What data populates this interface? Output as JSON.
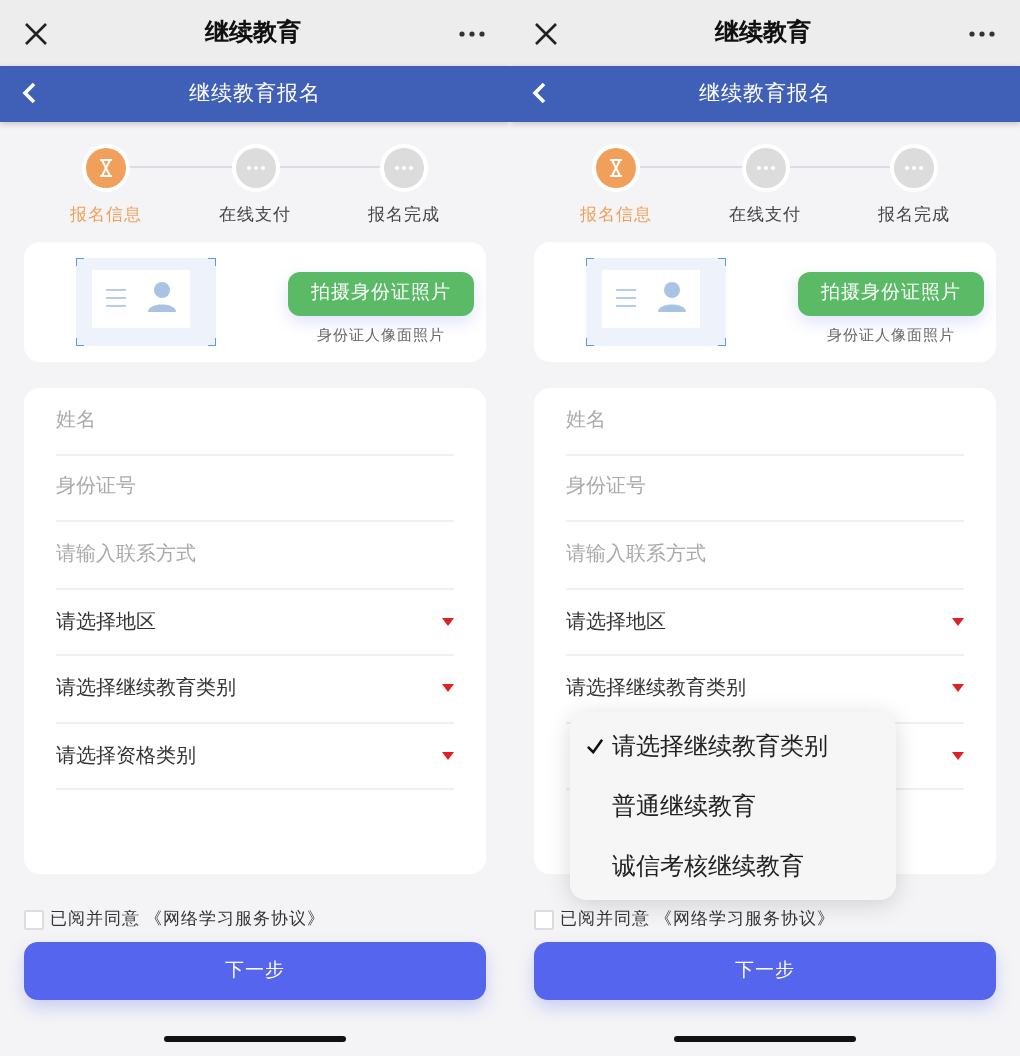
{
  "screens": [
    {
      "top_bar": {
        "title": "继续教育"
      },
      "header": {
        "title": "继续教育报名"
      },
      "steps": [
        {
          "label": "报名信息",
          "selected": true
        },
        {
          "label": "在线支付",
          "selected": false
        },
        {
          "label": "报名完成",
          "selected": false
        }
      ],
      "id_card": {
        "button": "拍摄身份证照片",
        "caption": "身份证人像面照片"
      },
      "fields": [
        {
          "kind": "input",
          "placeholder": "姓名"
        },
        {
          "kind": "input",
          "placeholder": "身份证号"
        },
        {
          "kind": "input",
          "placeholder": "请输入联系方式"
        },
        {
          "kind": "select",
          "label": "请选择地区"
        },
        {
          "kind": "select",
          "label": "请选择继续教育类别"
        },
        {
          "kind": "select",
          "label": "请选择资格类别"
        }
      ],
      "agreement": {
        "checked": false,
        "text": "已阅并同意 《网络学习服务协议》"
      },
      "next_button": "下一步"
    },
    {
      "top_bar": {
        "title": "继续教育"
      },
      "header": {
        "title": "继续教育报名"
      },
      "steps": [
        {
          "label": "报名信息",
          "selected": true
        },
        {
          "label": "在线支付",
          "selected": false
        },
        {
          "label": "报名完成",
          "selected": false
        }
      ],
      "id_card": {
        "button": "拍摄身份证照片",
        "caption": "身份证人像面照片"
      },
      "fields": [
        {
          "kind": "input",
          "placeholder": "姓名"
        },
        {
          "kind": "input",
          "placeholder": "身份证号"
        },
        {
          "kind": "input",
          "placeholder": "请输入联系方式"
        },
        {
          "kind": "select",
          "label": "请选择地区"
        },
        {
          "kind": "select",
          "label": "请选择继续教育类别"
        },
        {
          "kind": "select"
        }
      ],
      "agreement": {
        "checked": false,
        "text": "已阅并同意 《网络学习服务协议》"
      },
      "next_button": "下一步",
      "dropdown": [
        {
          "label": "请选择继续教育类别",
          "selected": true
        },
        {
          "label": "普通继续教育",
          "selected": false
        },
        {
          "label": "诚信考核继续教育",
          "selected": false
        }
      ]
    }
  ]
}
